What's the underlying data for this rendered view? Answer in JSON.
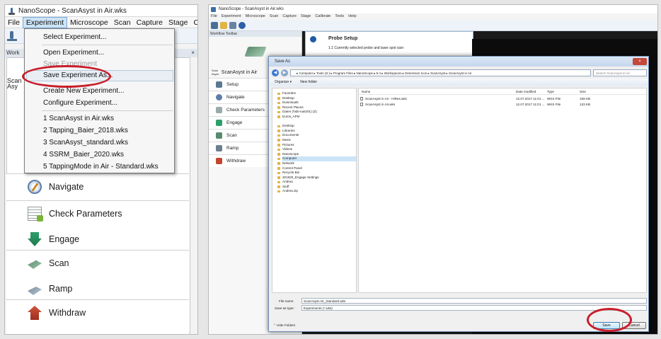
{
  "left": {
    "window_title": "NanoScope - ScanAsyst in Air.wks",
    "menu": [
      "File",
      "Experiment",
      "Microscope",
      "Scan",
      "Capture",
      "Stage",
      "Calibrate"
    ],
    "active_menu": "Experiment",
    "workspace_label": "Work",
    "close_glyph": "×",
    "scan_logo": [
      "Scan",
      "Asy"
    ],
    "dropdown": {
      "select_experiment": "Select Experiment...",
      "open_experiment": "Open Experiment...",
      "save_experiment": "Save Experiment",
      "save_experiment_as": "Save Experiment As...",
      "create_new_experiment": "Create New Experiment...",
      "configure_experiment": "Configure Experiment...",
      "recent": [
        "1 ScanAsyst in Air.wks",
        "2 Tapping_Baier_2018.wks",
        "3 ScanAsyst_standard.wks",
        "4 SSRM_Baier_2020.wks",
        "5 TappingMode in Air - Standard.wks"
      ]
    },
    "buttons": [
      "Navigate",
      "Check Parameters",
      "Engage",
      "Scan",
      "Ramp",
      "Withdraw"
    ]
  },
  "right": {
    "window_title": "NanoScope - ScanAsyst in Air.wks",
    "menu": [
      "File",
      "Experiment",
      "Microscope",
      "Scan",
      "Capture",
      "Stage",
      "Calibrate",
      "Tools",
      "Help"
    ],
    "workflow_label": "Workflow Toolbar",
    "scan_logo": [
      "Scan",
      "Asyst"
    ],
    "experiment_name": "ScanAsyst in Air",
    "buttons": [
      "Setup",
      "Navigate",
      "Check Parameters",
      "Engage",
      "Scan",
      "Ramp",
      "Withdraw"
    ],
    "probe_title": "Probe Setup",
    "probe_subtitle": "1.1 Currently selected probe and laser spot size:",
    "dialog": {
      "title": "Save As",
      "close": "×",
      "back_glyph": "◀",
      "forward_glyph": "▶",
      "address": "▸ Computer ▸ Tools (S:) ▸ Program Files ▸ NanoScope ▸ 9.4 ▸ Workspaces ▸ Dimension Icon ▸ ScanAsyst ▸ ScanAsyst in Air",
      "search_placeholder": "Search ScanAsyst in Air",
      "toolbar": [
        "Organize ▾",
        "New folder"
      ],
      "nav_items": [
        "Favorites",
        "Desktop",
        "Downloads",
        "Recent Places",
        "Daten (\\\\sbi-nas201) (Z)",
        "Euros_AFM",
        "",
        "Desktop",
        "Libraries",
        "Documents",
        "Music",
        "Pictures",
        "Videos",
        "Nanoscope",
        "Computer",
        "Network",
        "Control Panel",
        "Recycle Bin",
        "201820_Engage Settings",
        "Andrea",
        "Stuff",
        "Andrea.zip"
      ],
      "columns": [
        "Name",
        "Date modified",
        "Type",
        "Size"
      ],
      "files": [
        {
          "name": "ScanAsyst in Air - HiRes.wks",
          "date": "12.07.2017 11:01 ...",
          "type": "WKS File",
          "size": "159 KB"
        },
        {
          "name": "ScanAsyst in Air.wks",
          "date": "12.07.2017 11:01 ...",
          "type": "WKS File",
          "size": "133 KB"
        }
      ],
      "file_name_label": "File name:",
      "file_name_value": "ScanAsyst-Air_Standard.wks",
      "save_type_label": "Save as type:",
      "save_type_value": "Experiments (*.wks)",
      "hide_folders": "Hide Folders",
      "save": "Save",
      "cancel": "Cancel"
    }
  },
  "colors": {
    "highlight_ring": "#c81e2a",
    "menu_active": "#cde4f7"
  }
}
